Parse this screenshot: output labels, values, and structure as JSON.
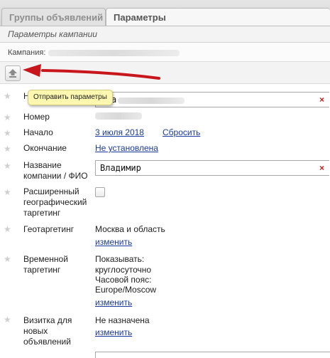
{
  "tabs": [
    {
      "label": "Группы объявлений",
      "active": false
    },
    {
      "label": "Параметры",
      "active": true
    }
  ],
  "subtitle": "Параметры кампании",
  "campaign": {
    "label": "Кампания:"
  },
  "toolbar": {
    "upload_icon": "upload-arrow-icon",
    "tooltip": "Отправить параметры"
  },
  "fields": {
    "name": {
      "label": "Н",
      "value_fragment": "а"
    },
    "number": {
      "label": "Номер"
    },
    "start": {
      "label": "Начало",
      "date": "3 июля 2018",
      "reset": "Сбросить"
    },
    "end": {
      "label": "Окончание",
      "value": "Не установлена"
    },
    "company": {
      "label_line1": "Название",
      "label_line2": "компании / ФИО",
      "value": "Владимир"
    },
    "ext_geo": {
      "label_line1": "Расширенный",
      "label_line2": "географический",
      "label_line3": "таргетинг",
      "checked": false
    },
    "geo": {
      "label": "Геотаргетинг",
      "value": "Москва и область",
      "edit": "изменить"
    },
    "time": {
      "label_line1": "Временной",
      "label_line2": "таргетинг",
      "value_line1": "Показывать:",
      "value_line2": "круглосуточно",
      "value_line3": "Часовой пояс:",
      "value_line4": "Europe/Moscow",
      "edit": "изменить"
    },
    "vcard": {
      "label_line1": "Визитка для",
      "label_line2": "новых",
      "label_line3": "объявлений",
      "value": "Не назначена",
      "edit": "изменить"
    }
  },
  "colors": {
    "accent_link": "#1a3a9e",
    "clear_x": "#d41d1d",
    "arrow": "#c8161d",
    "tooltip_bg": "#fdf7b0"
  }
}
